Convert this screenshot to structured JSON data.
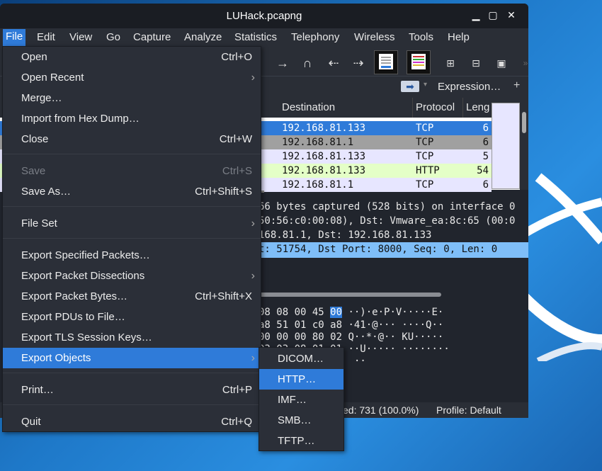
{
  "window": {
    "title": "LUHack.pcapng"
  },
  "menubar": [
    "File",
    "Edit",
    "View",
    "Go",
    "Capture",
    "Analyze",
    "Statistics",
    "Telephony",
    "Wireless",
    "Tools",
    "Help"
  ],
  "filter": {
    "expression_label": "Expression…",
    "plus": "+"
  },
  "packet_list": {
    "columns": [
      "Destination",
      "Protocol",
      "Leng"
    ],
    "rows": [
      {
        "dest": "192.168.81.133",
        "proto": "TCP",
        "len": "6",
        "bg": "#2f7bd9",
        "fg": "#ffffff"
      },
      {
        "dest": "192.168.81.1",
        "proto": "TCP",
        "len": "6",
        "bg": "#a0a0a0",
        "fg": "#101010"
      },
      {
        "dest": "192.168.81.133",
        "proto": "TCP",
        "len": "5",
        "bg": "#e7e6ff",
        "fg": "#101010"
      },
      {
        "dest": "192.168.81.133",
        "proto": "HTTP",
        "len": "54",
        "bg": "#e4ffc7",
        "fg": "#101010"
      },
      {
        "dest": "192.168.81.1",
        "proto": "TCP",
        "len": "6",
        "bg": "#e7e6ff",
        "fg": "#101010"
      }
    ]
  },
  "details": {
    "line1": "66 bytes captured (528 bits) on interface 0",
    "line2": "50:56:c0:00:08), Dst: Vmware_ea:8c:65 (00:0",
    "line3": "168.81.1, Dst: 192.168.81.133",
    "line4": "t: 51754, Dst Port: 8000, Seq: 0, Len: 0"
  },
  "hex": {
    "r1_hex": "08 08 00 45",
    "r1_sel": "00",
    "r1_asc": "  ··)·e·P·V·····E·",
    "r2_hex": "a8 51 01 c0 a8",
    "r2_asc": "  ·41·@··· ····Q··",
    "r3_hex": "00 00 00 80 02",
    "r3_asc": "  Q··*·@·· KU·····",
    "r4_hex": "03 03 08 01 01",
    "r4_asc": "  ··U····· ········",
    "r5_asc": "  ··"
  },
  "status": {
    "displayed": "ed: 731 (100.0%)",
    "profile": "Profile: Default"
  },
  "file_menu": [
    {
      "label": "Open",
      "shortcut": "Ctrl+O"
    },
    {
      "label": "Open Recent",
      "submenu": true
    },
    {
      "label": "Merge…"
    },
    {
      "label": "Import from Hex Dump…"
    },
    {
      "label": "Close",
      "shortcut": "Ctrl+W"
    },
    {
      "label": "Save",
      "shortcut": "Ctrl+S",
      "disabled": true
    },
    {
      "label": "Save As…",
      "shortcut": "Ctrl+Shift+S"
    },
    {
      "label": "File Set",
      "submenu": true
    },
    {
      "label": "Export Specified Packets…"
    },
    {
      "label": "Export Packet Dissections",
      "submenu": true
    },
    {
      "label": "Export Packet Bytes…",
      "shortcut": "Ctrl+Shift+X"
    },
    {
      "label": "Export PDUs to File…"
    },
    {
      "label": "Export TLS Session Keys…"
    },
    {
      "label": "Export Objects",
      "submenu": true,
      "highlighted": true
    },
    {
      "label": "Print…",
      "shortcut": "Ctrl+P"
    },
    {
      "label": "Quit",
      "shortcut": "Ctrl+Q"
    }
  ],
  "export_objects_menu": [
    {
      "label": "DICOM…"
    },
    {
      "label": "HTTP…",
      "highlighted": true
    },
    {
      "label": "IMF…"
    },
    {
      "label": "SMB…"
    },
    {
      "label": "TFTP…"
    }
  ],
  "colors": {
    "accent": "#2f7bd9",
    "menu_bg": "#2b2f38",
    "window_bg": "#21252d"
  }
}
